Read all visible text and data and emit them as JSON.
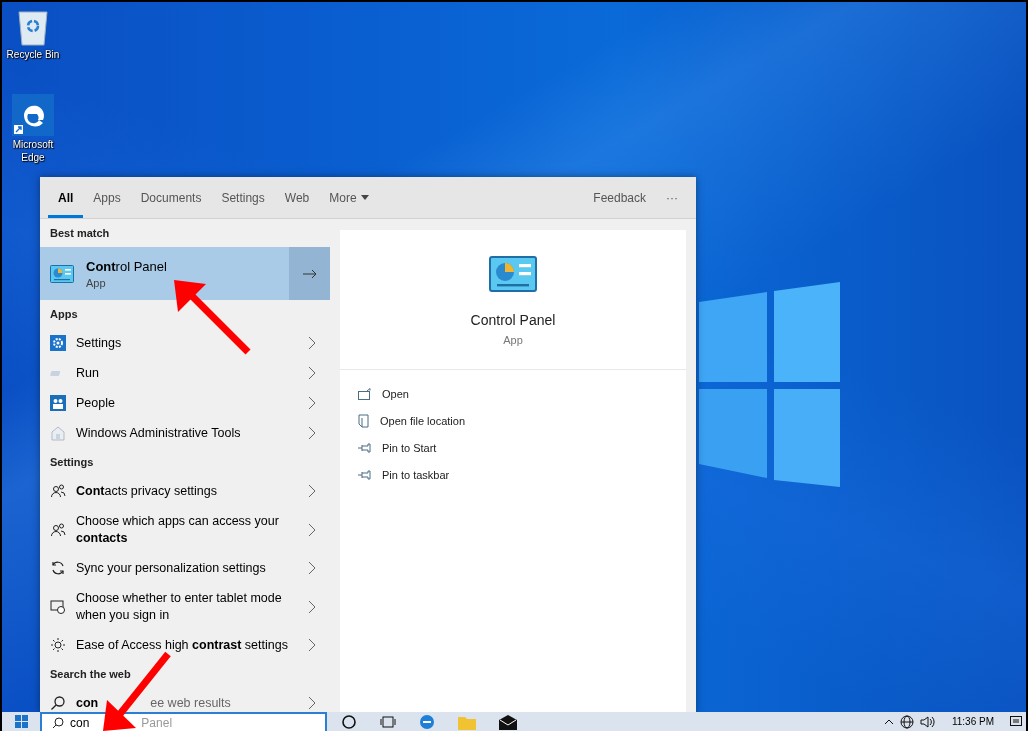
{
  "desktop_icons": [
    {
      "label": "Recycle Bin"
    },
    {
      "label": "Microsoft Edge"
    }
  ],
  "search_panel": {
    "tabs": [
      {
        "label": "All",
        "kind": "tab",
        "selected": true
      },
      {
        "label": "Apps",
        "kind": "tab",
        "selected": false
      },
      {
        "label": "Documents",
        "kind": "tab",
        "selected": false
      },
      {
        "label": "Settings",
        "kind": "tab",
        "selected": false
      },
      {
        "label": "Web",
        "kind": "tab",
        "selected": false
      },
      {
        "label": "More",
        "kind": "dropdown",
        "selected": false
      }
    ],
    "feedback": "Feedback",
    "more_options": "···",
    "best_match": {
      "heading": "Best match",
      "title": "**Cont**rol Panel",
      "subtitle": "App",
      "selected": true
    },
    "sections": [
      {
        "heading": "Apps",
        "items": [
          {
            "text": "Settings"
          },
          {
            "text": "Run"
          },
          {
            "text": "People"
          },
          {
            "text": "Windows Administrative Tools"
          }
        ]
      },
      {
        "heading": "Settings",
        "items": [
          {
            "text": "**Cont**acts privacy settings"
          },
          {
            "text": "Choose which apps can access your **contacts**"
          },
          {
            "text": "Sync your personalization settings"
          },
          {
            "text": "Choose whether to enter tablet mode when you sign in"
          },
          {
            "text": "Ease of Access high **contrast** settings"
          }
        ]
      },
      {
        "heading": "Search the web",
        "items": [
          {
            "text": "**con**",
            "text_2": "ee web results"
          }
        ]
      }
    ],
    "preview": {
      "title": "Control Panel",
      "subtitle": "App",
      "actions": [
        "Open",
        "Open file location",
        "Pin to Start",
        "Pin to taskbar"
      ]
    }
  },
  "taskbar": {
    "search": {
      "value": "con",
      "suggestion": "Panel"
    },
    "clock": "11:36 PM"
  }
}
